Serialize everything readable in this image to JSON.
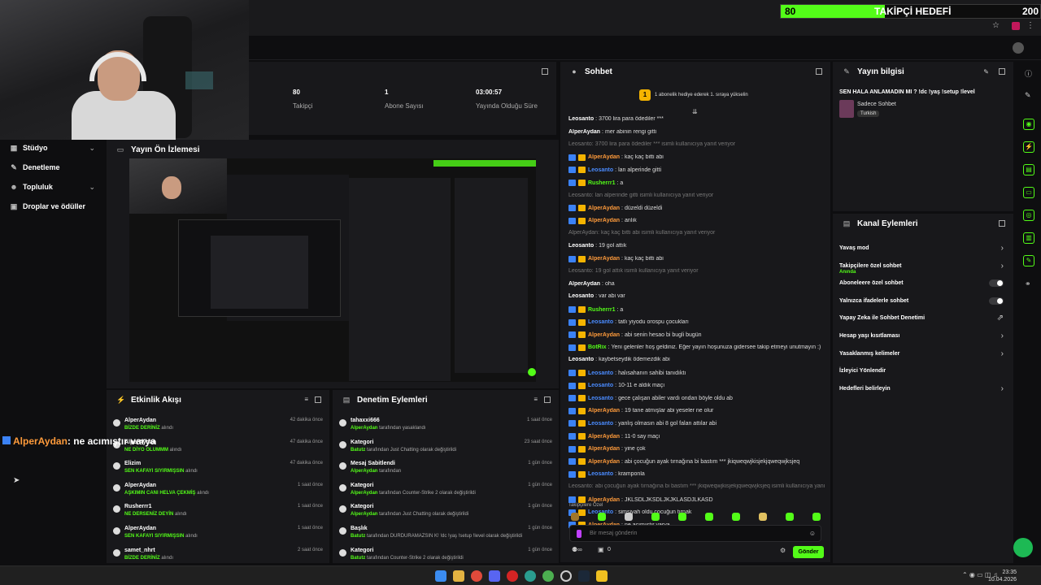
{
  "goal": {
    "current": "80",
    "title": "TAKİPÇİ HEDEFİ",
    "target": "200",
    "progress": 0.4
  },
  "stats": [
    {
      "value": "80",
      "label": "Takipçi"
    },
    {
      "value": "1",
      "label": "Abone Sayısı"
    },
    {
      "value": "03:00:57",
      "label": "Yayında Olduğu Süre"
    }
  ],
  "nav": [
    {
      "label": "Stüdyo",
      "icon": "studio-icon",
      "chevron": true
    },
    {
      "label": "Denetleme",
      "icon": "wrench-icon",
      "chevron": false
    },
    {
      "label": "Topluluk",
      "icon": "community-icon",
      "chevron": true
    },
    {
      "label": "Droplar ve ödüller",
      "icon": "drops-icon",
      "chevron": false
    }
  ],
  "preview": {
    "title": "Yayın Ön İzlemesi"
  },
  "chat": {
    "title": "Sohbet",
    "pinned": "1 abonelik hediye ederek 1. sıraya yükselin",
    "pinned_rank": "1",
    "messages": [
      {
        "user": "Leosanto",
        "text": "3700 lira para ödediler ***",
        "color": "#ffffff",
        "sys": false,
        "badge": false
      },
      {
        "user": "AlperAydan",
        "text": "mer abinin rengi gitti",
        "color": "#ffffff",
        "sys": false,
        "badge": false
      },
      {
        "user": "",
        "text": "Leosanto: 3700 lira para ödediler *** isimli kullanıcıya yanıt veriyor",
        "sys": true
      },
      {
        "user": "AlperAydan",
        "text": "kaç kaç bitti abi",
        "color": "#ff9b3b",
        "sys": false,
        "badge": true
      },
      {
        "user": "Leosanto",
        "text": "lan alperinde gitti",
        "color": "#4a8bff",
        "sys": false,
        "badge": true
      },
      {
        "user": "Rusherrr1",
        "text": "a",
        "color": "#53fc18",
        "sys": false,
        "badge": true
      },
      {
        "user": "",
        "text": "Leosanto: lan alperinde gitti isimli kullanıcıya yanıt veriyor",
        "sys": true
      },
      {
        "user": "AlperAydan",
        "text": "düzeldi düzeldi",
        "color": "#ff9b3b",
        "sys": false,
        "badge": true
      },
      {
        "user": "AlperAydan",
        "text": "anlık",
        "color": "#ff9b3b",
        "sys": false,
        "badge": true
      },
      {
        "user": "",
        "text": "AlperAydan: kaç kaç bitti abi isimli kullanıcıya yanıt veriyor",
        "sys": true
      },
      {
        "user": "Leosanto",
        "text": "19 gol attık",
        "color": "#ffffff",
        "sys": false,
        "badge": false
      },
      {
        "user": "AlperAydan",
        "text": "kaç kaç bitti abi",
        "color": "#ff9b3b",
        "sys": false,
        "badge": true
      },
      {
        "user": "",
        "text": "Leosanto: 19 gol attık isimli kullanıcıya yanıt veriyor",
        "sys": true
      },
      {
        "user": "AlperAydan",
        "text": "oha",
        "color": "#ffffff",
        "sys": false,
        "badge": false
      },
      {
        "user": "Leosanto",
        "text": "var abi var",
        "color": "#ffffff",
        "sys": false,
        "badge": false
      },
      {
        "user": "Rusherrr1",
        "text": "a",
        "color": "#53fc18",
        "sys": false,
        "badge": true
      },
      {
        "user": "Leosanto",
        "text": "tatlı yiyodu orospu çocukları",
        "color": "#4a8bff",
        "sys": false,
        "badge": true
      },
      {
        "user": "AlperAydan",
        "text": "abi senin hesao bi bugli bugün",
        "color": "#ff9b3b",
        "sys": false,
        "badge": true
      },
      {
        "user": "BotRix",
        "text": "Yeni gelenler hoş geldiniz. Eğer yayın hoşunuza gidersee takip etmeyi unutmayın :)",
        "color": "#53fc18",
        "sys": false,
        "badge": true
      },
      {
        "user": "Leosanto",
        "text": "kaybetseydik ödemezdik abi",
        "color": "#ffffff",
        "sys": false,
        "badge": false
      },
      {
        "user": "Leosanto",
        "text": "halısahanın sahibi tanıdıktı",
        "color": "#4a8bff",
        "sys": false,
        "badge": true
      },
      {
        "user": "Leosanto",
        "text": "10-11 e aldık maçı",
        "color": "#4a8bff",
        "sys": false,
        "badge": true
      },
      {
        "user": "Leosanto",
        "text": "gece çalışan abiler vardı ondan böyle oldu ab",
        "color": "#4a8bff",
        "sys": false,
        "badge": true
      },
      {
        "user": "AlperAydan",
        "text": "19 tane atmışlar abi yeseler ne olur",
        "color": "#ff9b3b",
        "sys": false,
        "badge": true
      },
      {
        "user": "Leosanto",
        "text": "yanlış olmasın abi 8 gol falan attılar abi",
        "color": "#4a8bff",
        "sys": false,
        "badge": true
      },
      {
        "user": "AlperAydan",
        "text": "11-0 say maçı",
        "color": "#ff9b3b",
        "sys": false,
        "badge": true
      },
      {
        "user": "AlperAydan",
        "text": "yine çok",
        "color": "#ff9b3b",
        "sys": false,
        "badge": true
      },
      {
        "user": "AlperAydan",
        "text": "abi çocuğun ayak tırnağına bi bastım *** jkiqweqwjkisjekjqweqwjksjeq",
        "color": "#ff9b3b",
        "sys": false,
        "badge": true
      },
      {
        "user": "Leosanto",
        "text": "kramponla",
        "color": "#4a8bff",
        "sys": false,
        "badge": true
      },
      {
        "user": "",
        "text": "Leosanto: abi çocuğun ayak tırnağına bi bastım *** jkiqweqwjkisjekjqweqwjksjeq isimli kullanıcıya yanıt v...",
        "sys": true
      },
      {
        "user": "AlperAydan",
        "text": "JKLSDLJKSDLJKJKLASDJLKASD",
        "color": "#ff9b3b",
        "sys": false,
        "badge": true
      },
      {
        "user": "Leosanto",
        "text": "simsiyah oldu çocuğun tırnak",
        "color": "#4a8bff",
        "sys": false,
        "badge": true
      },
      {
        "user": "AlperAydan",
        "text": "ne acımıştır varya",
        "color": "#ff9b3b",
        "sys": false,
        "badge": true
      }
    ],
    "followers_only": "Takipçilere Özel",
    "input_placeholder": "Bir mesaj gönderin",
    "send_label": "Gönder",
    "count": "0"
  },
  "info": {
    "title": "Yayın bilgisi",
    "stream_title": "SEN HALA ANLAMADIN MI ? !dc !yaş !setup !level",
    "category": "Sadece Sohbet",
    "language": "Turkish"
  },
  "actions": {
    "title": "Kanal Eylemleri",
    "items": [
      {
        "label": "Yavaş mod",
        "kind": "chevron",
        "sub": ""
      },
      {
        "label": "Takipçilere özel sohbet",
        "kind": "chevron",
        "sub": "Anında"
      },
      {
        "label": "Aboneleere özel sohbet",
        "kind": "toggle",
        "sub": ""
      },
      {
        "label": "Yalnızca ifadelerle sohbet",
        "kind": "toggle",
        "sub": ""
      },
      {
        "label": "Yapay Zeka ile Sohbet Denetimi",
        "kind": "external",
        "sub": ""
      },
      {
        "label": "Hesap yaşı kısıtlaması",
        "kind": "chevron",
        "sub": ""
      },
      {
        "label": "Yasaklanmış kelimeler",
        "kind": "chevron",
        "sub": ""
      },
      {
        "label": "İzleyici Yönlendir",
        "kind": "none",
        "sub": ""
      },
      {
        "label": "Hedefleri belirleyin",
        "kind": "chevron",
        "sub": ""
      }
    ]
  },
  "activity": {
    "title": "Etkinlik Akışı",
    "items": [
      {
        "name": "AlperAydan",
        "sub": "BİZDE DERİNİZ",
        "suffix": "alındı",
        "time": "42 dakika önce"
      },
      {
        "name": "AlperAydan",
        "sub": "NE DİYO OLUMMM",
        "suffix": "alındı",
        "time": "47 dakika önce"
      },
      {
        "name": "Elizim",
        "sub": "SEN KAFAYI SIYIRMIŞSIN",
        "suffix": "alındı",
        "time": "47 dakika önce"
      },
      {
        "name": "AlperAydan",
        "sub": "AŞKIMIN CANI HELVA ÇEKMİŞ",
        "suffix": "alındı",
        "time": "1 saat önce"
      },
      {
        "name": "Rusherrr1",
        "sub": "NE DERSENİZ DEYİN",
        "suffix": "alındı",
        "time": "1 saat önce"
      },
      {
        "name": "AlperAydan",
        "sub": "SEN KAFAYI SIYIRMIŞSIN",
        "suffix": "alındı",
        "time": "1 saat önce"
      },
      {
        "name": "samet_nhrt",
        "sub": "BİZDE DERİNİZ",
        "suffix": "alındı",
        "time": "2 saat önce"
      }
    ]
  },
  "modlog": {
    "title": "Denetim Eylemleri",
    "items": [
      {
        "name": "tahaxxi666",
        "actor": "AlperAydan",
        "text": "tarafından yasaklandı",
        "time": "1 saat önce"
      },
      {
        "name": "Kategori",
        "actor": "Batutz",
        "text": "tarafından Just Chatting olarak değiştirildi",
        "time": "23 saat önce"
      },
      {
        "name": "Mesaj Sabitlendi",
        "actor": "AlperAydan",
        "text": "tarafından",
        "time": "1 gün önce"
      },
      {
        "name": "Kategori",
        "actor": "AlperAydan",
        "text": "tarafından Counter-Strike 2 olarak değiştirildi",
        "time": "1 gün önce"
      },
      {
        "name": "Kategori",
        "actor": "AlperAydan",
        "text": "tarafından Just Chatting olarak değiştirildi",
        "time": "1 gün önce"
      },
      {
        "name": "Başlık",
        "actor": "Batutz",
        "text": "tarafından DURDURAMAZSIN K! !dc !yaş !setup !level olarak değiştirildi",
        "time": "1 gün önce"
      },
      {
        "name": "Kategori",
        "actor": "Batutz",
        "text": "tarafından Counter-Strike 2 olarak değiştirildi",
        "time": "1 gün önce"
      }
    ]
  },
  "overlay_chat": {
    "user": "AlperAydan",
    "text": ": ne acımıştır varya"
  },
  "clock": {
    "time": "23:35",
    "date": "10.04.2026"
  },
  "colors": {
    "accent": "#53fc18",
    "bg": "#0e0e10",
    "panel": "#18181b"
  }
}
